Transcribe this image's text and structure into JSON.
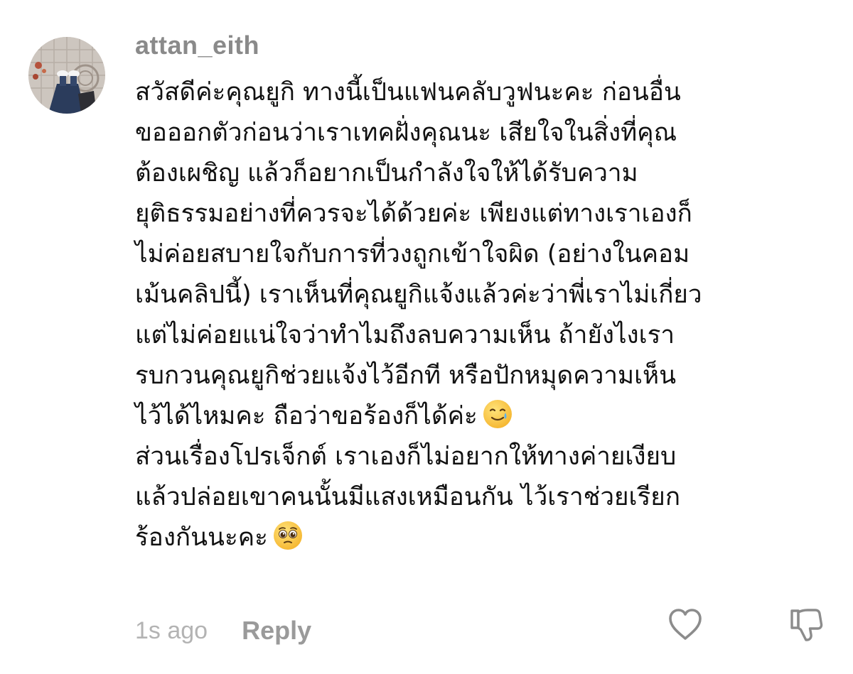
{
  "comment": {
    "username": "attan_eith",
    "lines": [
      "สวัสดีค่ะคุณยูกิ ทางนี้เป็นแฟนคลับวูฟนะคะ ก่อนอื่น",
      "ขอออกตัวก่อนว่าเราเทคฝั่งคุณนะ เสียใจในสิ่งที่คุณ",
      "ต้องเผชิญ แล้วก็อยากเป็นกำลังใจให้ได้รับความ",
      "ยุติธรรมอย่างที่ควรจะได้ด้วยค่ะ เพียงแต่ทางเราเองก็",
      "ไม่ค่อยสบายใจกับการที่วงถูกเข้าใจผิด (อย่างในคอม",
      "เม้นคลิปนี้) เราเห็นที่คุณยูกิแจ้งแล้วค่ะว่าพี่เราไม่เกี่ยว",
      "แต่ไม่ค่อยแน่ใจว่าทำไมถึงลบความเห็น ถ้ายังไงเรา",
      "รบกวนคุณยูกิช่วยแจ้งไว้อีกที หรือปักหมุดความเห็น",
      "ไว้ได้ไหมคะ ถือว่าขอร้องก็ได้ค่ะ",
      "ส่วนเรื่องโปรเจ็กต์ เราเองก็ไม่อยากให้ทางค่ายเงียบ",
      "แล้วปล่อยเขาคนนั้นมีแสงเหมือนกัน ไว้เราช่วยเรียก",
      "ร้องกันนะคะ"
    ],
    "emoji_line_9": "smiling-face-with-tear",
    "emoji_line_12": "pleading-face",
    "timestamp": "1s ago",
    "reply_label": "Reply",
    "icons": {
      "like": "heart-outline-icon",
      "dislike": "thumbs-down-outline-icon"
    }
  },
  "colors": {
    "username": "#8a8a8a",
    "text": "#111111",
    "timestamp": "#b3b3b3",
    "reply": "#9a9a9a",
    "icon": "#8c8c8c"
  }
}
